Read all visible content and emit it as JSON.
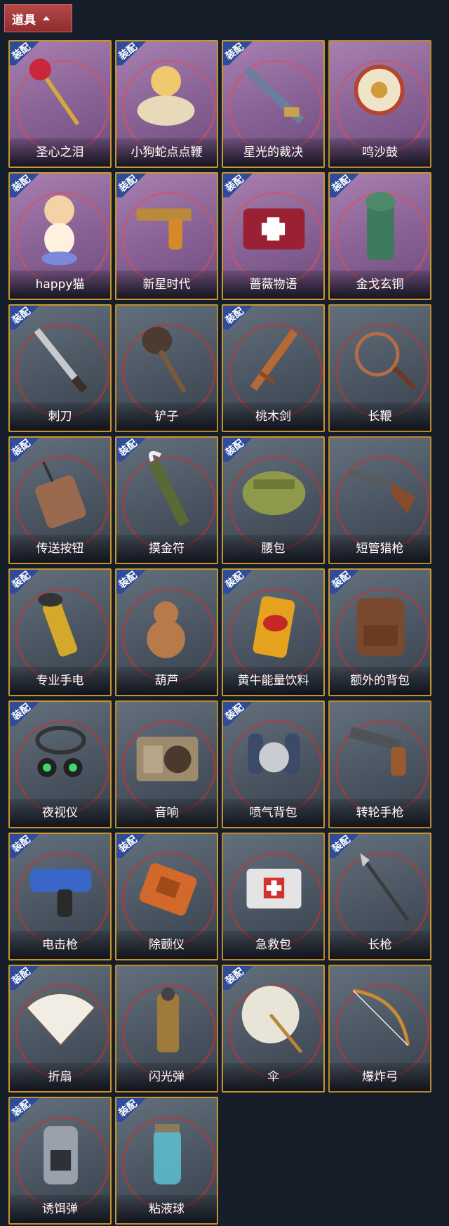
{
  "header": {
    "label": "道具"
  },
  "badge_label": "装配",
  "items": [
    {
      "name": "圣心之泪",
      "equipped": true,
      "style": "purple",
      "icon": "scepter-icon"
    },
    {
      "name": "小狗蛇点点鞭",
      "equipped": true,
      "style": "purple",
      "icon": "snake-toy-icon"
    },
    {
      "name": "星光的裁决",
      "equipped": true,
      "style": "purple",
      "icon": "shotgun-icon"
    },
    {
      "name": "鸣沙鼓",
      "equipped": false,
      "style": "purple",
      "icon": "drum-icon"
    },
    {
      "name": "happy猫",
      "equipped": true,
      "style": "purple",
      "icon": "cat-figure-icon"
    },
    {
      "name": "新星时代",
      "equipped": true,
      "style": "purple",
      "icon": "revolver-icon"
    },
    {
      "name": "蔷薇物语",
      "equipped": true,
      "style": "purple",
      "icon": "medkit-icon"
    },
    {
      "name": "金戈玄铜",
      "equipped": true,
      "style": "purple",
      "icon": "bronze-grenade-icon"
    },
    {
      "name": "刺刀",
      "equipped": true,
      "style": "grey",
      "icon": "bayonet-icon"
    },
    {
      "name": "铲子",
      "equipped": false,
      "style": "grey",
      "icon": "shovel-icon"
    },
    {
      "name": "桃木剑",
      "equipped": true,
      "style": "grey",
      "icon": "wooden-sword-icon"
    },
    {
      "name": "长鞭",
      "equipped": false,
      "style": "grey",
      "icon": "whip-icon"
    },
    {
      "name": "传送按钮",
      "equipped": true,
      "style": "grey",
      "icon": "teleport-remote-icon"
    },
    {
      "name": "摸金符",
      "equipped": true,
      "style": "grey",
      "icon": "talisman-icon"
    },
    {
      "name": "腰包",
      "equipped": true,
      "style": "grey",
      "icon": "waist-bag-icon"
    },
    {
      "name": "短管猎枪",
      "equipped": false,
      "style": "grey",
      "icon": "sawed-off-shotgun-icon"
    },
    {
      "name": "专业手电",
      "equipped": true,
      "style": "grey",
      "icon": "flashlight-icon"
    },
    {
      "name": "葫芦",
      "equipped": true,
      "style": "grey",
      "icon": "gourd-icon"
    },
    {
      "name": "黄牛能量饮料",
      "equipped": true,
      "style": "grey",
      "icon": "energy-drink-icon"
    },
    {
      "name": "额外的背包",
      "equipped": true,
      "style": "grey",
      "icon": "backpack-icon"
    },
    {
      "name": "夜视仪",
      "equipped": true,
      "style": "grey",
      "icon": "night-vision-icon"
    },
    {
      "name": "音响",
      "equipped": false,
      "style": "grey",
      "icon": "radio-speaker-icon"
    },
    {
      "name": "喷气背包",
      "equipped": true,
      "style": "grey",
      "icon": "jetpack-icon"
    },
    {
      "name": "转轮手枪",
      "equipped": false,
      "style": "grey",
      "icon": "revolver-pistol-icon"
    },
    {
      "name": "电击枪",
      "equipped": true,
      "style": "grey",
      "icon": "stun-gun-icon"
    },
    {
      "name": "除颤仪",
      "equipped": true,
      "style": "grey",
      "icon": "defibrillator-icon"
    },
    {
      "name": "急救包",
      "equipped": false,
      "style": "grey",
      "icon": "first-aid-kit-icon"
    },
    {
      "name": "长枪",
      "equipped": true,
      "style": "grey",
      "icon": "spear-icon"
    },
    {
      "name": "折扇",
      "equipped": true,
      "style": "grey",
      "icon": "folding-fan-icon"
    },
    {
      "name": "闪光弹",
      "equipped": false,
      "style": "grey",
      "icon": "flashbang-icon"
    },
    {
      "name": "伞",
      "equipped": true,
      "style": "grey",
      "icon": "umbrella-icon"
    },
    {
      "name": "爆炸弓",
      "equipped": false,
      "style": "grey",
      "icon": "explosive-bow-icon"
    },
    {
      "name": "诱饵弹",
      "equipped": true,
      "style": "grey",
      "icon": "decoy-grenade-icon"
    },
    {
      "name": "粘液球",
      "equipped": true,
      "style": "grey",
      "icon": "slime-ball-icon"
    }
  ]
}
